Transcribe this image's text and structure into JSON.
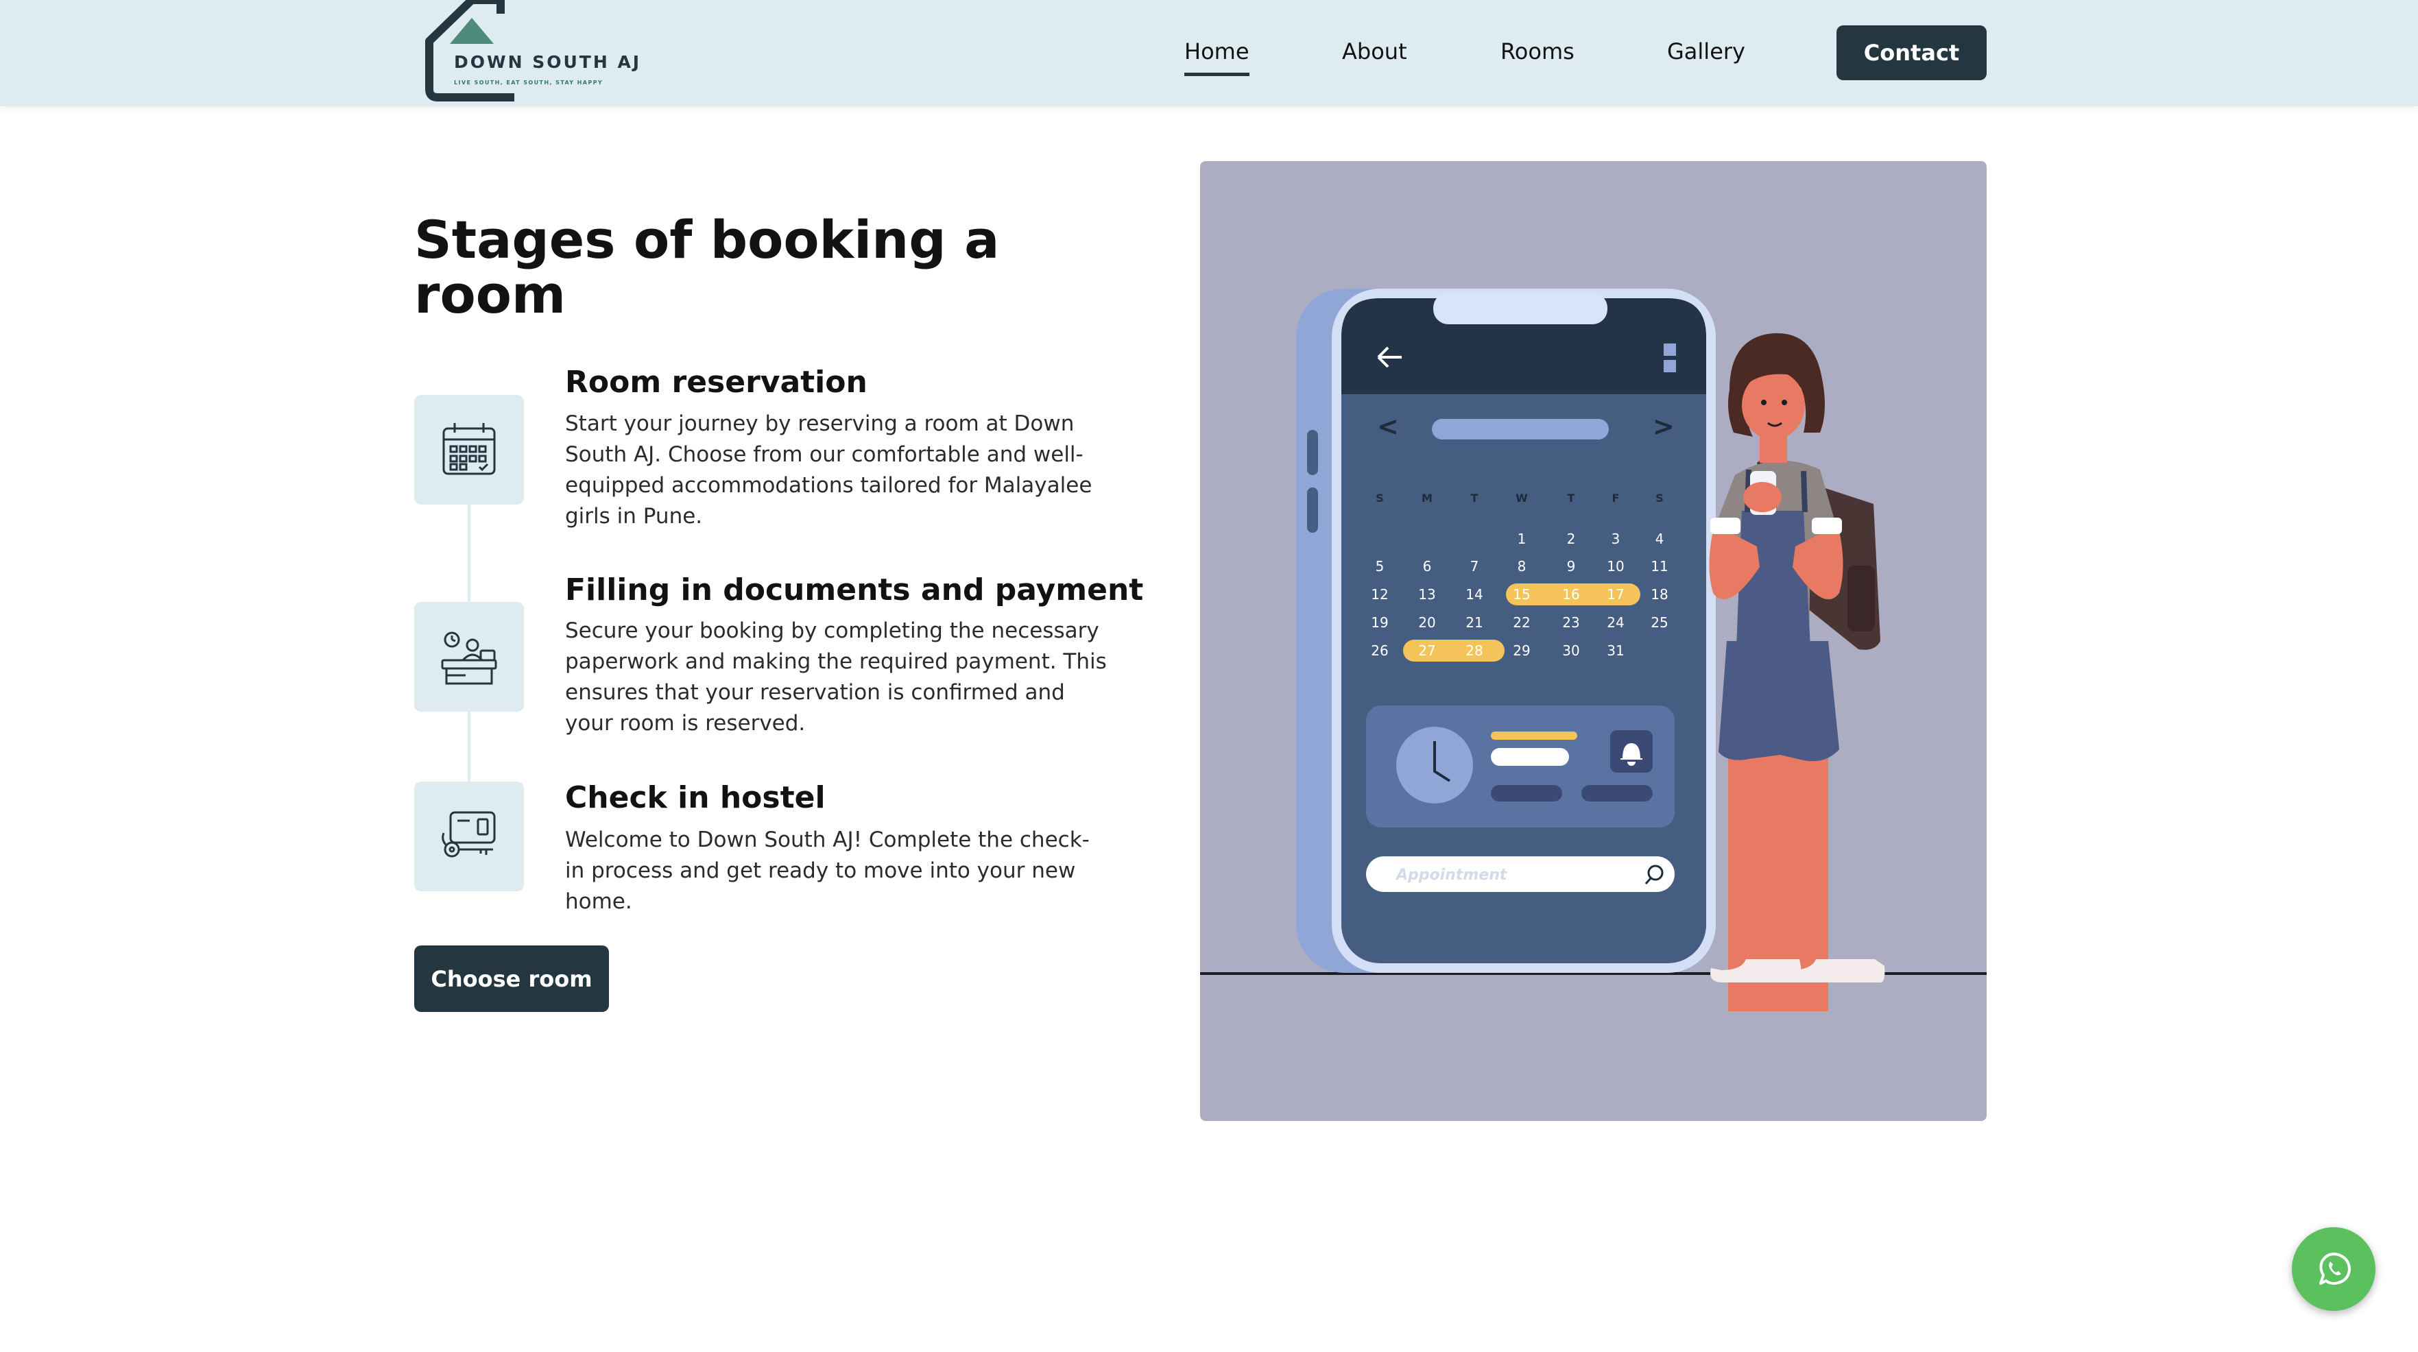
{
  "brand": {
    "name": "DOWN SOUTH AJ",
    "tagline": "LIVE SOUTH, EAT SOUTH, STAY HAPPY",
    "icon": "house-logo-icon"
  },
  "nav": {
    "items": [
      {
        "label": "Home",
        "active": true
      },
      {
        "label": "About",
        "active": false
      },
      {
        "label": "Rooms",
        "active": false
      },
      {
        "label": "Gallery",
        "active": false
      }
    ],
    "contact_label": "Contact"
  },
  "section": {
    "title": "Stages of booking a room",
    "stages": [
      {
        "icon": "calendar-icon",
        "title": "Room reservation",
        "description": "Start your journey by reserving a room at Down South AJ. Choose from our comfortable and well-equipped accommodations tailored for Malayalee girls in Pune."
      },
      {
        "icon": "reception-desk-icon",
        "title": "Filling in documents and payment",
        "description": "Secure your booking by completing the necessary paperwork and making the required payment. This ensures that your reservation is confirmed and your room is reserved."
      },
      {
        "icon": "key-card-icon",
        "title": "Check in hostel",
        "description": "Welcome to Down South AJ! Complete the check-in process and get ready to move into your new home."
      }
    ],
    "cta_label": "Choose room"
  },
  "illustration": {
    "nav_prev": "<",
    "nav_next": ">",
    "weekdays": [
      "S",
      "M",
      "T",
      "W",
      "T",
      "F",
      "S"
    ],
    "calendar_rows": [
      [
        "",
        "",
        "",
        "1",
        "2",
        "3",
        "4"
      ],
      [
        "5",
        "6",
        "7",
        "8",
        "9",
        "10",
        "11"
      ],
      [
        "12",
        "13",
        "14",
        "15",
        "16",
        "17",
        "18"
      ],
      [
        "19",
        "20",
        "21",
        "22",
        "23",
        "24",
        "25"
      ],
      [
        "26",
        "27",
        "28",
        "29",
        "30",
        "31",
        ""
      ]
    ],
    "highlighted_dates": [
      "15",
      "16",
      "17",
      "27",
      "28"
    ],
    "search_placeholder": "Appointment",
    "colors": {
      "background": "#acacc2",
      "phone_screen": "#455d80",
      "highlight": "#f4c45a"
    }
  },
  "floating": {
    "whatsapp_icon": "whatsapp-icon",
    "color": "#5bc15f"
  },
  "colors": {
    "header_bg": "#deebf0",
    "primary_dark": "#243640",
    "icon_tile": "#deebf0"
  }
}
